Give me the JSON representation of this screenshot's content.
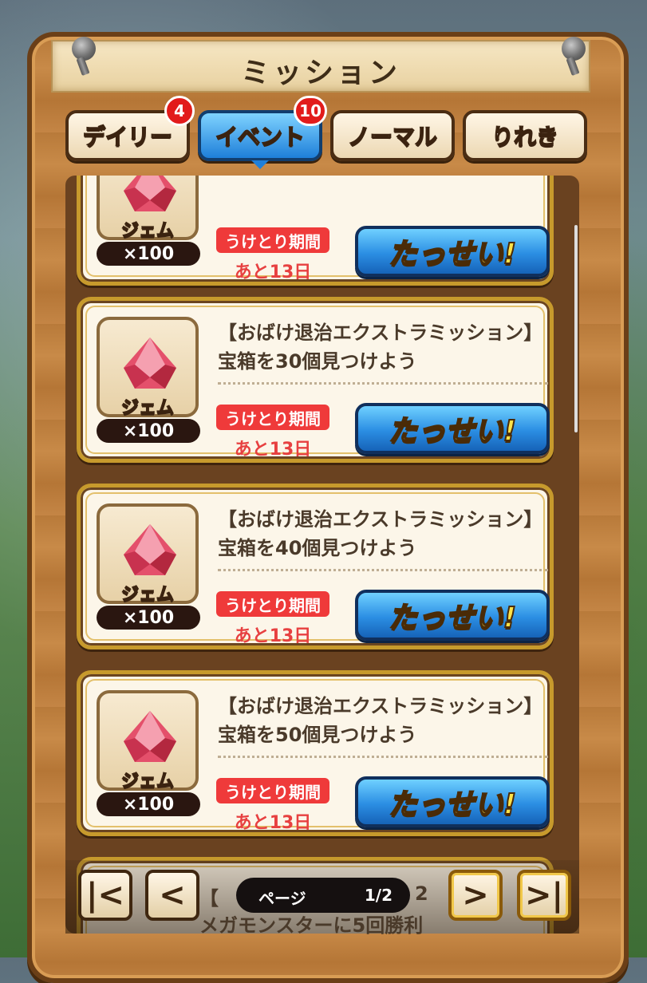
{
  "header": {
    "title": "ミッション"
  },
  "tabs": [
    {
      "label": "デイリー",
      "badge": "4",
      "active": false
    },
    {
      "label": "イベント",
      "badge": "10",
      "active": true
    },
    {
      "label": "ノーマル",
      "badge": "",
      "active": false
    },
    {
      "label": "りれき",
      "badge": "",
      "active": false
    }
  ],
  "missions": [
    {
      "text1": "",
      "text2": "",
      "reward_name": "ジェム",
      "reward_qty": "×100",
      "period_label": "うけとり期間",
      "period_remaining": "あと13日",
      "button_label": "たっせい!"
    },
    {
      "text1": "【おばけ退治エクストラミッション】",
      "text2": "宝箱を30個見つけよう",
      "reward_name": "ジェム",
      "reward_qty": "×100",
      "period_label": "うけとり期間",
      "period_remaining": "あと13日",
      "button_label": "たっせい!"
    },
    {
      "text1": "【おばけ退治エクストラミッション】",
      "text2": "宝箱を40個見つけよう",
      "reward_name": "ジェム",
      "reward_qty": "×100",
      "period_label": "うけとり期間",
      "period_remaining": "あと13日",
      "button_label": "たっせい!"
    },
    {
      "text1": "【おばけ退治エクストラミッション】",
      "text2": "宝箱を50個見つけよう",
      "reward_name": "ジェム",
      "reward_qty": "×100",
      "period_label": "うけとり期間",
      "period_remaining": "あと13日",
      "button_label": "たっせい!"
    }
  ],
  "peek": {
    "line1": "【",
    "line1_tail": "2",
    "line2": "メガモンスターに5回勝利"
  },
  "pager": {
    "label": "ページ",
    "value": "1/2",
    "first": "|<",
    "prev": "<",
    "next": ">",
    "last": ">|"
  },
  "colors": {
    "accent_blue": "#2b8ee3",
    "badge_red": "#e21b1b",
    "period_red": "#ef3a3a",
    "button_text_yellow": "#ffe34a"
  },
  "icons": {
    "reward": "gem-icon",
    "pin": "pin-icon"
  }
}
